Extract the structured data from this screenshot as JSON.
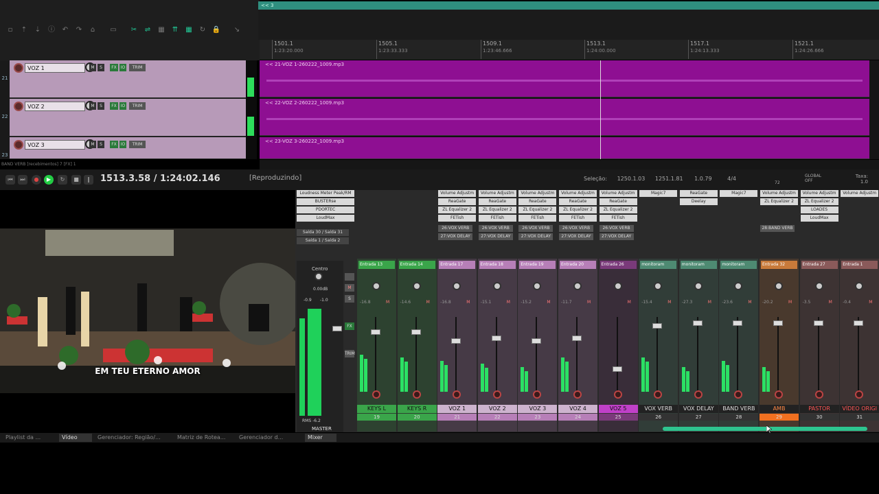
{
  "region_bar": {
    "label": "<< 3"
  },
  "ruler": [
    {
      "bar": "1501.1",
      "time": "1:23:20.000"
    },
    {
      "bar": "1505.1",
      "time": "1:23:33.333"
    },
    {
      "bar": "1509.1",
      "time": "1:23:46.666"
    },
    {
      "bar": "1513.1",
      "time": "1:24:00.000"
    },
    {
      "bar": "1517.1",
      "time": "1:24:13.333"
    },
    {
      "bar": "1521.1",
      "time": "1:24:26.666"
    }
  ],
  "tracks": [
    {
      "num": "21",
      "name": "VOZ 1",
      "item": "<< 21-VOZ 1-260222_1009.mp3"
    },
    {
      "num": "22",
      "name": "VOZ 2",
      "item": "<< 22-VOZ 2-260222_1009.mp3"
    },
    {
      "num": "23",
      "name": "VOZ 3",
      "item": "<< 23-VOZ 3-260222_1009.mp3"
    }
  ],
  "track_buttons": {
    "m": "M",
    "s": "S",
    "fx": "FX",
    "io": "IO",
    "trim": "TRIM"
  },
  "tcp_status": "BAND VERB [recebimentos] 7 [FX] 1",
  "transport": {
    "position": "1513.3.58 / 1:24:02.146",
    "status": "[Reproduzindo]",
    "sel_label": "Seleção:",
    "sel_start": "1250.1.03",
    "sel_end": "1251.1.81",
    "sel_len": "1.0.79",
    "timesig": "4/4",
    "bpm": "72",
    "global": "GLOBAL",
    "global_state": "OFF",
    "rate_label": "Taxa:",
    "rate": "1.0"
  },
  "video": {
    "lyric": "EM TEU ETERNO AMOR"
  },
  "master_fx": [
    "Loudness Meter Peak/RM",
    "BUSTERse",
    "PDORTEC",
    "LoudMax"
  ],
  "master_sends": [
    "Saída 30 / Saída 31",
    "Saída 1 / Saída 2"
  ],
  "master": {
    "label": "Centro",
    "db": "0.00dB",
    "peak_l": "-0.9",
    "peak_r": "-1.0",
    "rms_label": "RMS",
    "rms_val": "-6.2",
    "name": "MASTER"
  },
  "strips": [
    {
      "name": "KEYS L",
      "num": "19",
      "input": "Entrada 13",
      "color": "#3aa54a",
      "namebg": "#3aa54a",
      "meter": 0.6,
      "fader": 0.2,
      "db": "-16.8",
      "fx": []
    },
    {
      "name": "KEYS R",
      "num": "20",
      "input": "Entrada 14",
      "color": "#3aa54a",
      "namebg": "#3aa54a",
      "meter": 0.55,
      "fader": 0.2,
      "db": "-14.6",
      "fx": []
    },
    {
      "name": "VOZ 1",
      "num": "21",
      "input": "Entrada 17",
      "color": "#b77fb8",
      "namebg": "#cdb3ce",
      "meter": 0.5,
      "fader": 0.35,
      "db": "-16.8",
      "fx": [
        "Volume Adjustm",
        "ReaGate",
        "ZL Equalizer 2",
        "FETish"
      ],
      "sends": [
        "26:VOX VERB",
        "27:VOX DELAY"
      ]
    },
    {
      "name": "VOZ 2",
      "num": "22",
      "input": "Entrada 18",
      "color": "#b77fb8",
      "namebg": "#cdb3ce",
      "meter": 0.45,
      "fader": 0.3,
      "db": "-15.1",
      "fx": [
        "Volume Adjustm",
        "ReaGate",
        "ZL Equalizer 2",
        "FETish"
      ],
      "sends": [
        "26:VOX VERB",
        "27:VOX DELAY"
      ]
    },
    {
      "name": "VOZ 3",
      "num": "23",
      "input": "Entrada 19",
      "color": "#b77fb8",
      "namebg": "#cdb3ce",
      "meter": 0.4,
      "fader": 0.35,
      "db": "-15.2",
      "fx": [
        "Volume Adjustm",
        "ReaGate",
        "ZL Equalizer 2",
        "FETish"
      ],
      "sends": [
        "26:VOX VERB",
        "27:VOX DELAY"
      ]
    },
    {
      "name": "VOZ 4",
      "num": "24",
      "input": "Entrada 20",
      "color": "#b77fb8",
      "namebg": "#cdb3ce",
      "meter": 0.55,
      "fader": 0.3,
      "db": "-11.7",
      "fx": [
        "Volume Adjustm",
        "ReaGate",
        "ZL Equalizer 2",
        "FETish"
      ],
      "sends": [
        "26:VOX VERB",
        "27:VOX DELAY"
      ]
    },
    {
      "name": "VOZ 5",
      "num": "25",
      "input": "Entrada 26",
      "color": "#7a3a7a",
      "namebg": "#c040c8",
      "meter": 0.0,
      "fader": 0.8,
      "db": "",
      "fx": [
        "Volume Adjustm",
        "ReaGate",
        "ZL Equalizer 2",
        "FETish"
      ],
      "sends": [
        "26:VOX VERB",
        "27:VOX DELAY"
      ]
    },
    {
      "name": "VOX VERB",
      "num": "26",
      "input": "monitoram",
      "color": "#4e8a72",
      "namebg": "#222",
      "meter": 0.55,
      "fader": 0.1,
      "db": "-15.4",
      "fx": [
        "Magic7"
      ]
    },
    {
      "name": "VOX DELAY",
      "num": "27",
      "input": "monitoram",
      "color": "#4e8a72",
      "namebg": "#222",
      "meter": 0.4,
      "fader": 0.05,
      "db": "-27.3",
      "fx": [
        "ReaGate",
        "Deelay"
      ]
    },
    {
      "name": "BAND VERB",
      "num": "28",
      "input": "monitoram",
      "color": "#4e8a72",
      "namebg": "#222",
      "meter": 0.5,
      "fader": 0.05,
      "db": "-23.6",
      "fx": [
        "Magic7"
      ]
    },
    {
      "name": "AMB",
      "num": "29",
      "input": "Entrada 32",
      "color": "#c87a3a",
      "namebg": "#222",
      "meter": 0.4,
      "fader": 0.05,
      "db": "-20.2",
      "fx": [
        "Volume Adjustm",
        "ZL Equalizer 2"
      ],
      "sends": [
        "28:BAND VERB"
      ]
    },
    {
      "name": "PASTOR",
      "num": "30",
      "input": "Entrada 27",
      "color": "#8a5a5a",
      "namebg": "#222",
      "meter": 0.0,
      "fader": 0.05,
      "db": "-3.5",
      "fx": [
        "Volume Adjustm",
        "ZL Equalizer 2",
        "LOADES",
        "LoudMax"
      ]
    },
    {
      "name": "VÍDEO ORIGI",
      "num": "31",
      "input": "Entrada 1",
      "color": "#8a5a5a",
      "namebg": "#222",
      "meter": 0.0,
      "fader": 0.05,
      "db": "-0.4",
      "fx": [
        "Volume Adjustm"
      ]
    }
  ],
  "tabs": [
    "Playlist da ...",
    "Vídeo",
    "Gerenciador: Região/...",
    "Matriz de Rotea...",
    "Gerenciador d...",
    "Mixer"
  ]
}
